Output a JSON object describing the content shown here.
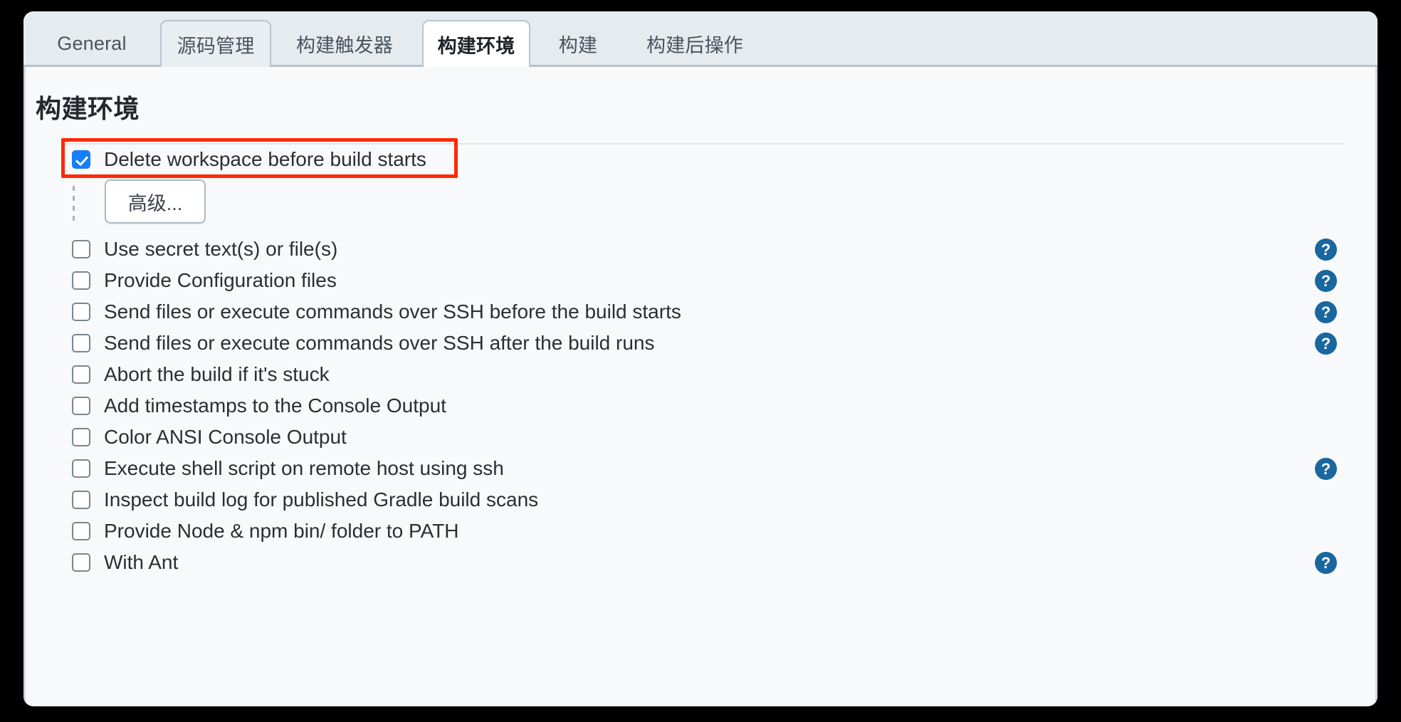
{
  "tabs": [
    {
      "label": "General",
      "state": "normal"
    },
    {
      "label": "源码管理",
      "state": "hovered"
    },
    {
      "label": "构建触发器",
      "state": "normal"
    },
    {
      "label": "构建环境",
      "state": "active"
    },
    {
      "label": "构建",
      "state": "normal"
    },
    {
      "label": "构建后操作",
      "state": "normal"
    }
  ],
  "section": {
    "title": "构建环境"
  },
  "advanced_button": {
    "label": "高级..."
  },
  "help_icon_glyph": "?",
  "colors": {
    "checkbox_checked": "#167ef8",
    "help_icon": "#19679f",
    "annotation_box": "#fb2a04",
    "tab_bar_bg": "#e6ebef",
    "panel_bg": "#f8f9fa"
  },
  "options": [
    {
      "label": "Delete workspace before build starts",
      "checked": true,
      "help": false,
      "annotated": true
    },
    {
      "label": "Use secret text(s) or file(s)",
      "checked": false,
      "help": true,
      "annotated": false
    },
    {
      "label": "Provide Configuration files",
      "checked": false,
      "help": true,
      "annotated": false
    },
    {
      "label": "Send files or execute commands over SSH before the build starts",
      "checked": false,
      "help": true,
      "annotated": false
    },
    {
      "label": "Send files or execute commands over SSH after the build runs",
      "checked": false,
      "help": true,
      "annotated": false
    },
    {
      "label": "Abort the build if it's stuck",
      "checked": false,
      "help": false,
      "annotated": false
    },
    {
      "label": "Add timestamps to the Console Output",
      "checked": false,
      "help": false,
      "annotated": false
    },
    {
      "label": "Color ANSI Console Output",
      "checked": false,
      "help": false,
      "annotated": false
    },
    {
      "label": "Execute shell script on remote host using ssh",
      "checked": false,
      "help": true,
      "annotated": false
    },
    {
      "label": "Inspect build log for published Gradle build scans",
      "checked": false,
      "help": false,
      "annotated": false
    },
    {
      "label": "Provide Node & npm bin/ folder to PATH",
      "checked": false,
      "help": false,
      "annotated": false
    },
    {
      "label": "With Ant",
      "checked": false,
      "help": true,
      "annotated": false
    }
  ]
}
